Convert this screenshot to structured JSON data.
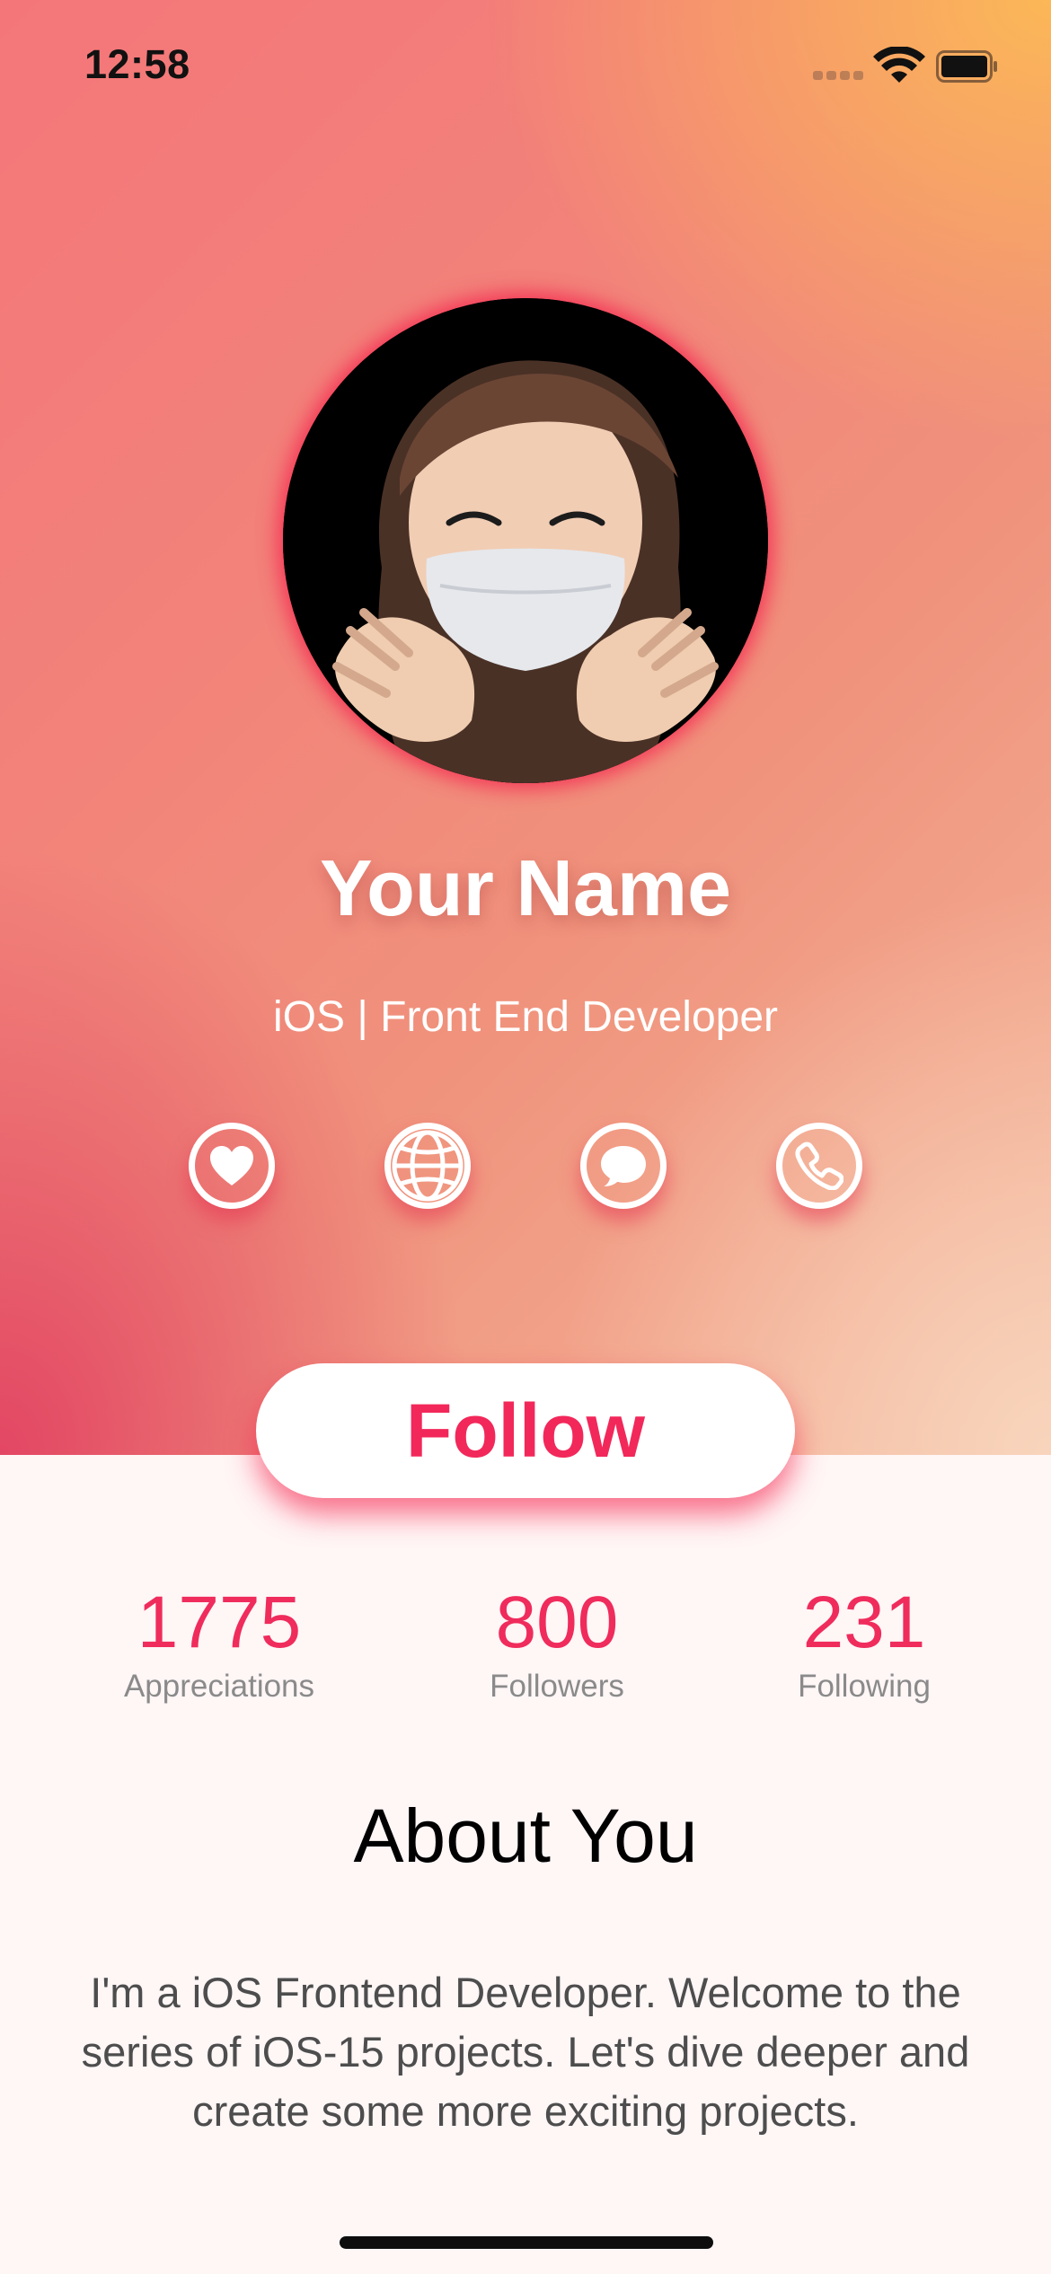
{
  "status_bar": {
    "time": "12:58"
  },
  "profile": {
    "name": "Your Name",
    "subtitle": "iOS | Front End Developer",
    "avatar_icon": "memoji-avatar"
  },
  "actions": [
    {
      "icon": "heart-icon"
    },
    {
      "icon": "globe-icon"
    },
    {
      "icon": "message-icon"
    },
    {
      "icon": "phone-icon"
    }
  ],
  "follow_button": {
    "label": "Follow"
  },
  "stats": [
    {
      "value": "1775",
      "label": "Appreciations"
    },
    {
      "value": "800",
      "label": "Followers"
    },
    {
      "value": "231",
      "label": "Following"
    }
  ],
  "about": {
    "title": "About You",
    "text": "I'm a iOS Frontend Developer. Welcome to the series of iOS-15 projects. Let's dive deeper and create some more exciting projects."
  },
  "colors": {
    "accent": "#f2285a",
    "gradient_top_right": "#fcba55",
    "gradient_bottom_left": "#e24262",
    "background": "#fff6f6"
  }
}
